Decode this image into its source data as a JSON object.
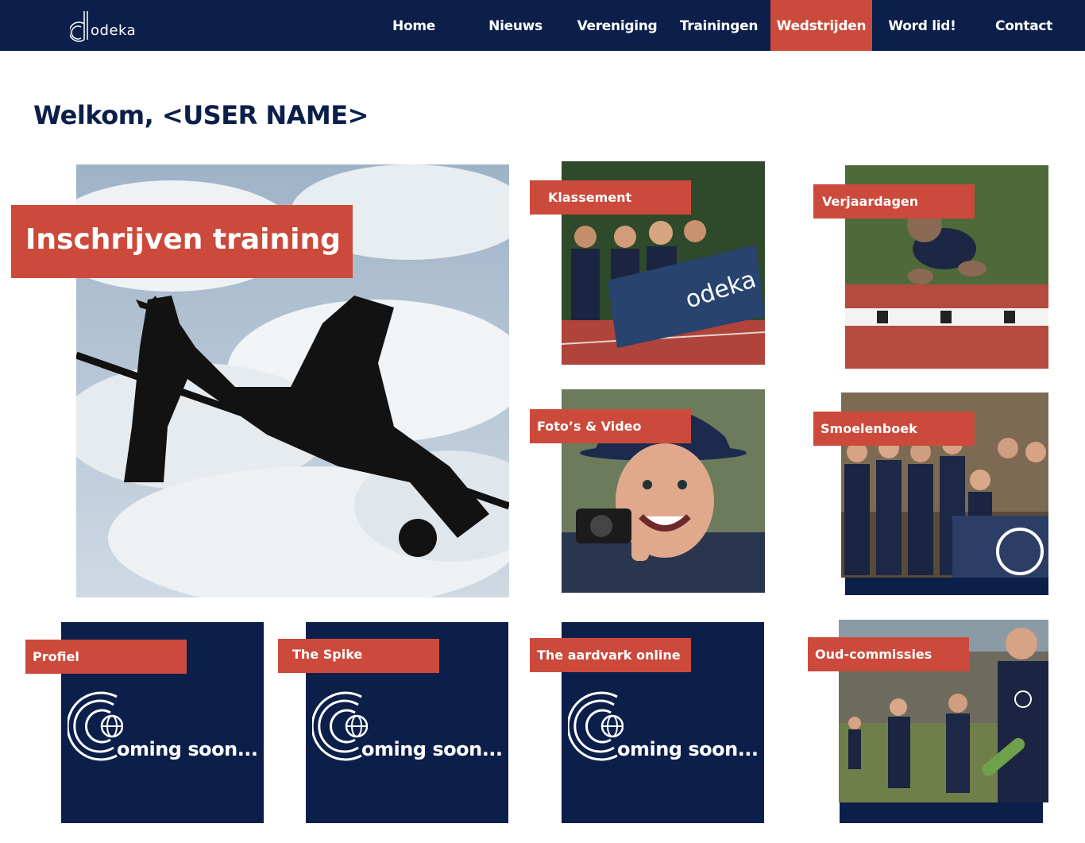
{
  "brand": {
    "logo_text": "odeka",
    "navy": "#0c1f4a",
    "accent": "#cb4a3c"
  },
  "nav": {
    "items": [
      {
        "label": "Home"
      },
      {
        "label": "Nieuws"
      },
      {
        "label": "Vereniging"
      },
      {
        "label": "Trainingen"
      },
      {
        "label": "Wedstrijden",
        "active": true
      },
      {
        "label": "Word lid!"
      },
      {
        "label": "Contact"
      }
    ]
  },
  "welcome": "Welkom, <USER NAME>",
  "tiles": {
    "training": "Inschrijven training",
    "klassement": "Klassement",
    "verjaardagen": "Verjaardagen",
    "fotos": "Foto’s & Video",
    "smoelenboek": "Smoelenboek",
    "profiel": "Profiel",
    "spike": "The Spike",
    "aardvark": "The aardvark online",
    "oudcommissies": "Oud-commissies"
  },
  "coming_soon": "oming soon..."
}
